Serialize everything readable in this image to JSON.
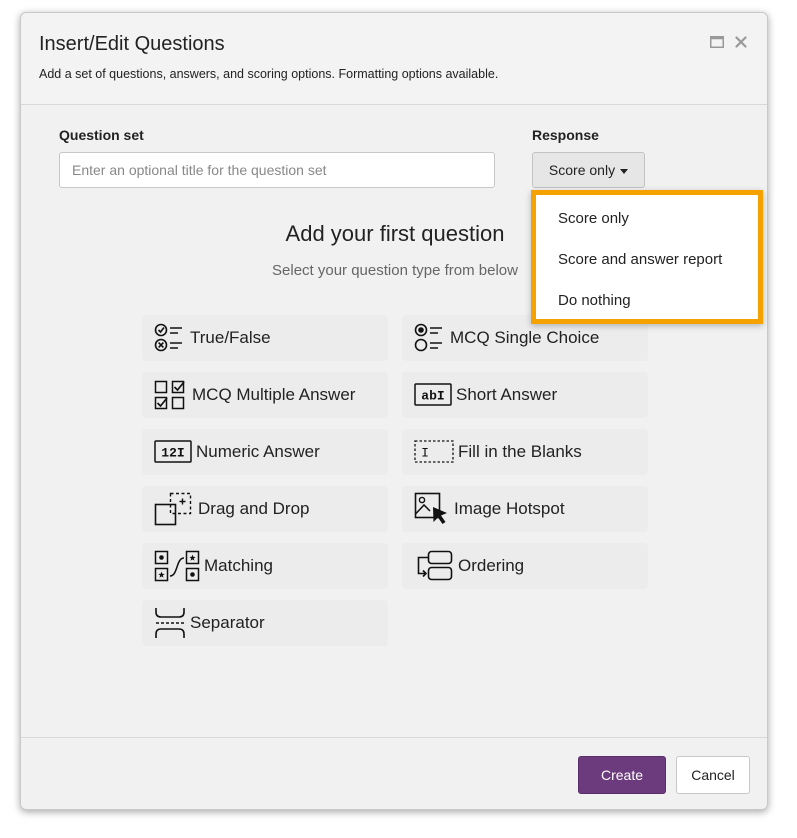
{
  "dialog": {
    "title": "Insert/Edit Questions",
    "subtitle": "Add a set of questions, answers, and scoring options. Formatting options available.",
    "maximize_icon": "window-maximize-icon",
    "close_icon": "close-icon"
  },
  "question_set": {
    "label": "Question set",
    "value": "",
    "placeholder": "Enter an optional title for the question set"
  },
  "response": {
    "label": "Response",
    "selected": "Score only",
    "options": [
      "Score only",
      "Score and answer report",
      "Do nothing"
    ],
    "highlight_color": "#f5a200"
  },
  "empty_state": {
    "title": "Add your first question",
    "subtitle": "Select your question type from below"
  },
  "question_types": [
    {
      "label": "True/False",
      "icon": "true-false-icon"
    },
    {
      "label": "MCQ Single Choice",
      "icon": "single-choice-icon"
    },
    {
      "label": "MCQ Multiple Answer",
      "icon": "multiple-answer-icon"
    },
    {
      "label": "Short Answer",
      "icon": "short-answer-icon"
    },
    {
      "label": "Numeric Answer",
      "icon": "numeric-answer-icon"
    },
    {
      "label": "Fill in the Blanks",
      "icon": "fill-blanks-icon"
    },
    {
      "label": "Drag and Drop",
      "icon": "drag-drop-icon"
    },
    {
      "label": "Image Hotspot",
      "icon": "image-hotspot-icon"
    },
    {
      "label": "Matching",
      "icon": "matching-icon"
    },
    {
      "label": "Ordering",
      "icon": "ordering-icon"
    },
    {
      "label": "Separator",
      "icon": "separator-icon"
    }
  ],
  "icon_text": {
    "short_answer": "abI",
    "numeric": "12I",
    "fill_blank": "I"
  },
  "footer": {
    "create_label": "Create",
    "cancel_label": "Cancel",
    "create_color": "#6c3b7d"
  }
}
